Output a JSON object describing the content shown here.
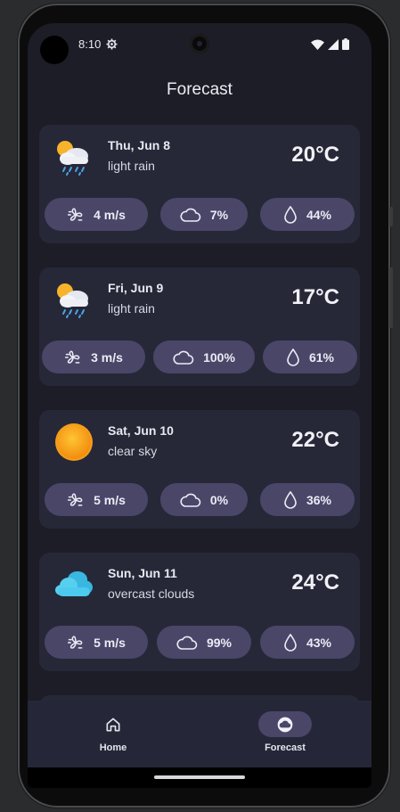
{
  "status_bar": {
    "time": "8:10"
  },
  "app": {
    "title": "Forecast"
  },
  "forecast": [
    {
      "date": "Thu, Jun 8",
      "description": "light rain",
      "temperature": "20°C",
      "icon": "rain-cloud-sun-icon",
      "wind": "4 m/s",
      "clouds": "7%",
      "humidity": "44%"
    },
    {
      "date": "Fri, Jun 9",
      "description": "light rain",
      "temperature": "17°C",
      "icon": "rain-cloud-sun-icon",
      "wind": "3 m/s",
      "clouds": "100%",
      "humidity": "61%"
    },
    {
      "date": "Sat, Jun 10",
      "description": "clear sky",
      "temperature": "22°C",
      "icon": "sun-icon",
      "wind": "5 m/s",
      "clouds": "0%",
      "humidity": "36%"
    },
    {
      "date": "Sun, Jun 11",
      "description": "overcast clouds",
      "temperature": "24°C",
      "icon": "overcast-clouds-icon",
      "wind": "5 m/s",
      "clouds": "99%",
      "humidity": "43%"
    }
  ],
  "nav": [
    {
      "label": "Home",
      "icon": "home-icon",
      "selected": false
    },
    {
      "label": "Forecast",
      "icon": "cloud-icon",
      "selected": true
    }
  ],
  "colors": {
    "background": "#1c1d27",
    "card": "#262838",
    "pill": "#4a4668",
    "text": "#ececf2"
  }
}
